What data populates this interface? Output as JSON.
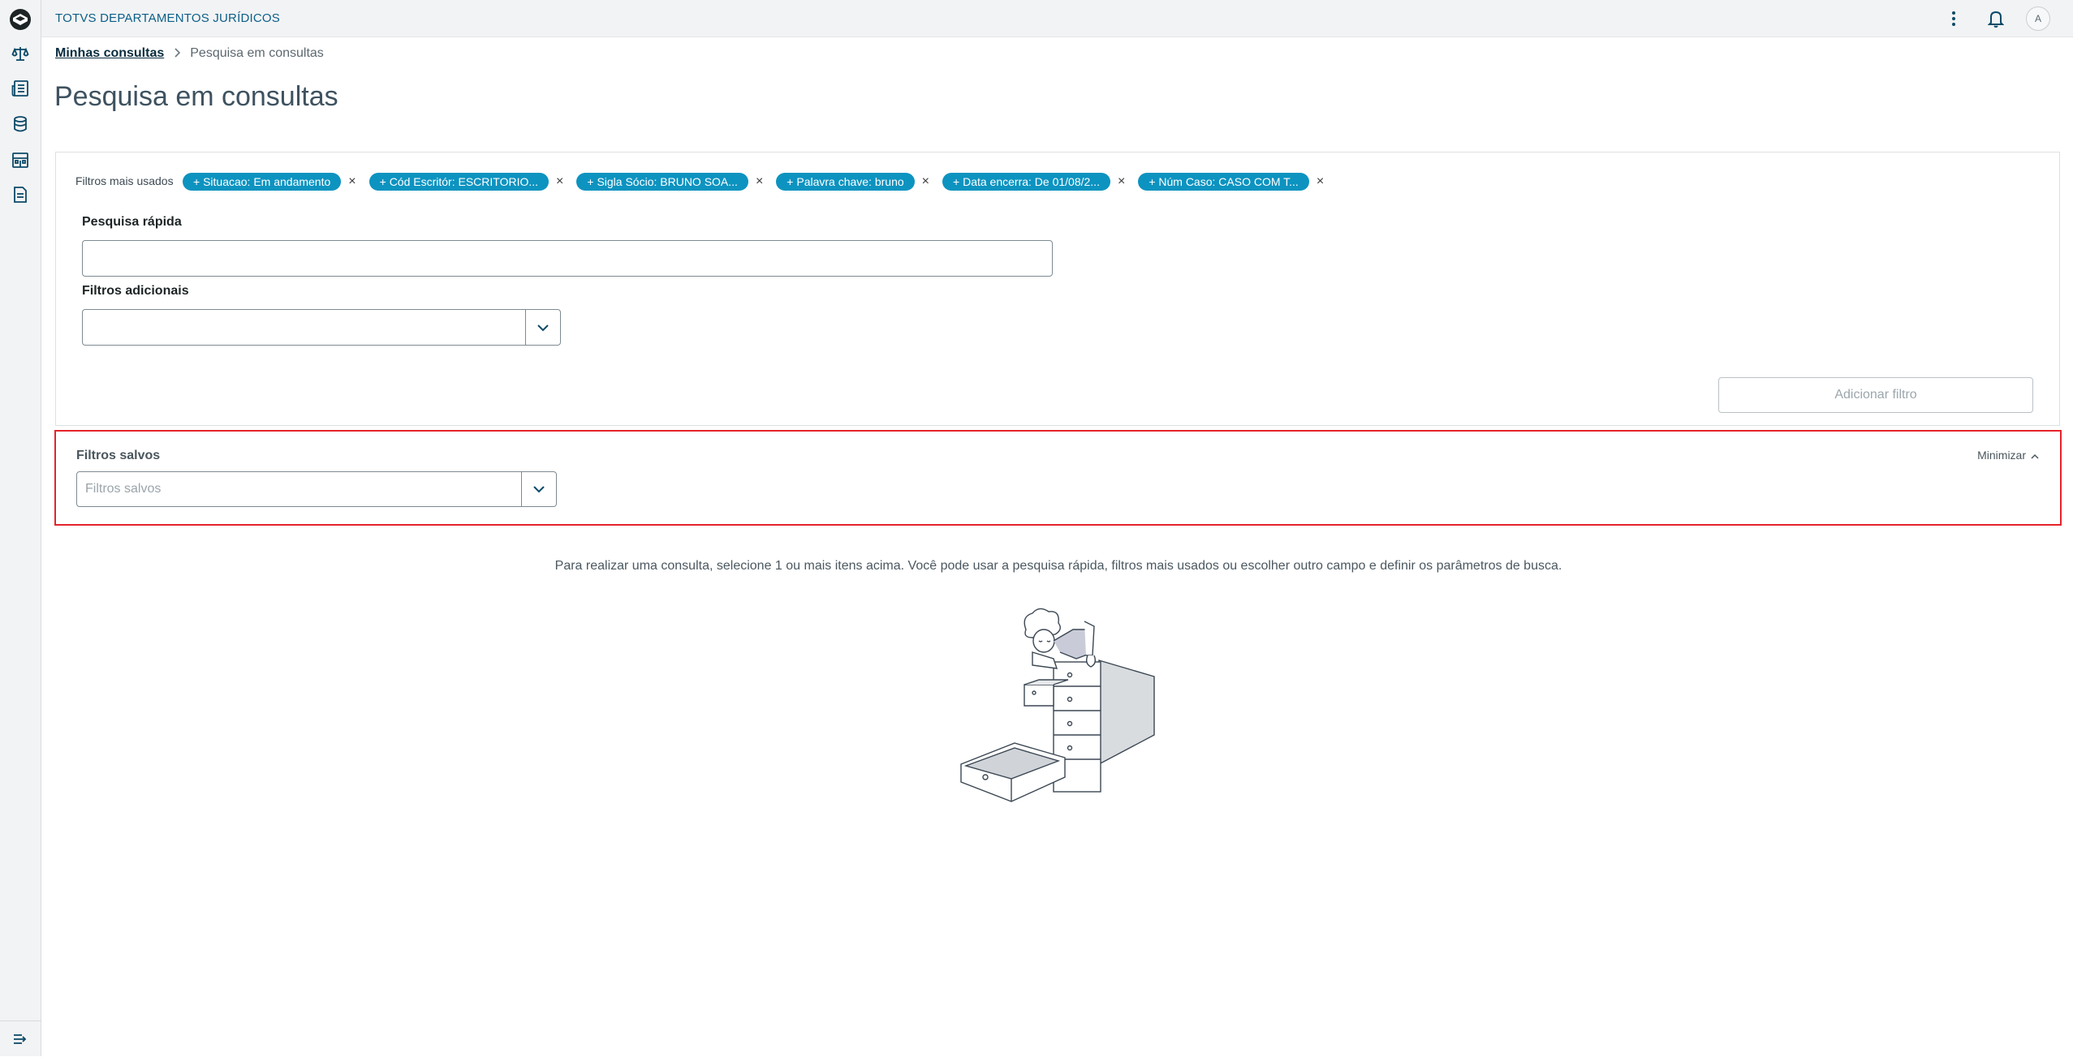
{
  "app": {
    "title": "TOTVS DEPARTAMENTOS JURÍDICOS"
  },
  "sidebar": {
    "items": [
      {
        "icon": "scale-icon"
      },
      {
        "icon": "newspaper-icon"
      },
      {
        "icon": "database-icon"
      },
      {
        "icon": "building-icon"
      },
      {
        "icon": "document-icon"
      }
    ],
    "bottom_icon": "expand-menu-icon"
  },
  "topbar": {
    "avatar_initial": "A"
  },
  "breadcrumb": {
    "parent": "Minhas consultas",
    "current": "Pesquisa em consultas"
  },
  "page": {
    "title": "Pesquisa em consultas"
  },
  "filters": {
    "label": "Filtros mais usados",
    "chips": [
      {
        "label": "+ Situacao: Em andamento"
      },
      {
        "label": "+ Cód Escritór: ESCRITORIO..."
      },
      {
        "label": "+ Sigla Sócio: BRUNO SOA..."
      },
      {
        "label": "+ Palavra chave: bruno"
      },
      {
        "label": "+ Data encerra: De 01/08/2..."
      },
      {
        "label": "+ Núm Caso: CASO COM T..."
      }
    ],
    "chip_remove": "×"
  },
  "quick_search": {
    "label": "Pesquisa rápida",
    "value": "",
    "placeholder": ""
  },
  "additional_filters": {
    "label": "Filtros adicionais",
    "value": ""
  },
  "add_filter_button": "Adicionar filtro",
  "saved_filters": {
    "title": "Filtros salvos",
    "placeholder": "Filtros salvos",
    "minimize_label": "Minimizar"
  },
  "empty_state": {
    "hint": "Para realizar uma consulta, selecione 1 ou mais itens acima. Você pode usar a pesquisa rápida, filtros mais usados ou escolher outro campo e definir os parâmetros de busca."
  },
  "colors": {
    "accent": "#0d93c0",
    "highlight_border": "#e5232b",
    "brand": "#0c5f88"
  }
}
